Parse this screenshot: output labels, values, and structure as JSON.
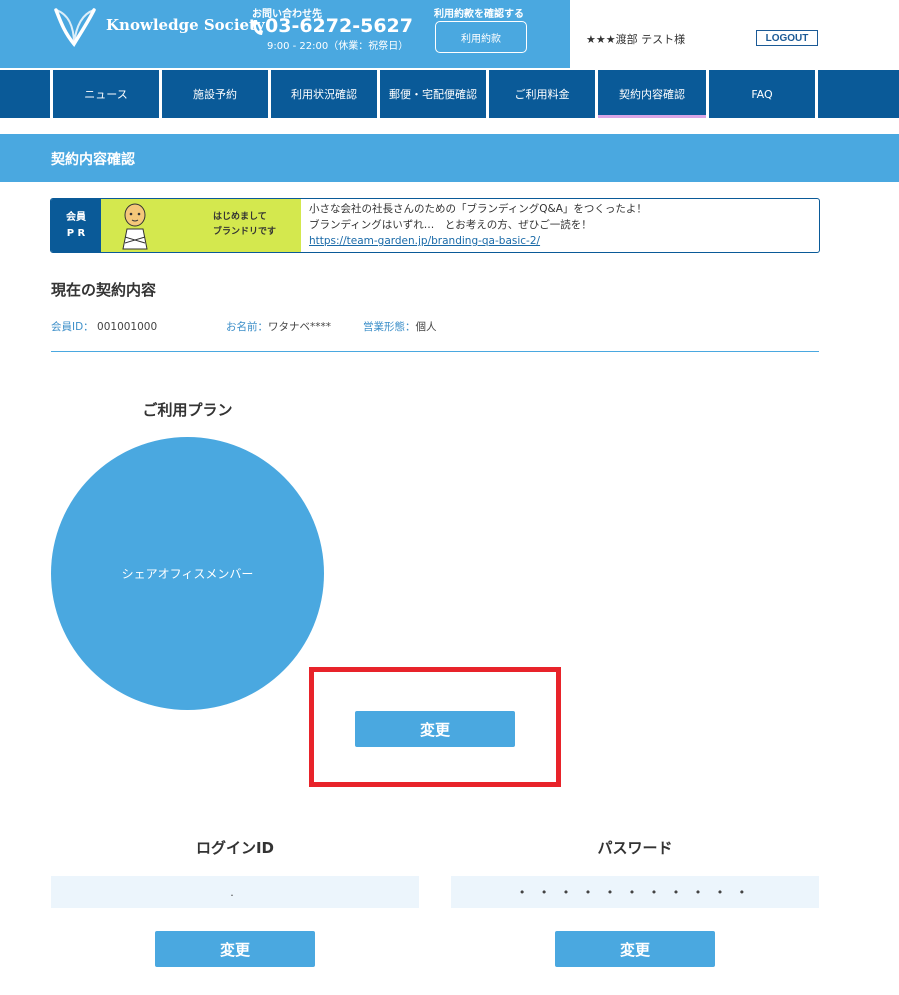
{
  "header": {
    "logo_text": "Knowledge Society",
    "contact_label": "お問い合わせ先",
    "phone": "03-6272-5627",
    "hours": "9:00 - 22:00（休業：祝祭日）",
    "terms_label": "利用約款を確認する",
    "terms_button": "利用約款",
    "user_name": "★★★渡部 テスト様",
    "logout": "LOGOUT",
    "colors": {
      "header_blue": "#4aa8e0",
      "nav_blue": "#0a5a98",
      "active_underline": "#d9a6e6"
    }
  },
  "nav": {
    "items": [
      {
        "label": "ニュース"
      },
      {
        "label": "施設予約"
      },
      {
        "label": "利用状況確認"
      },
      {
        "label": "郵便・宅配便確認"
      },
      {
        "label": "ご利用料金"
      },
      {
        "label": "契約内容確認",
        "active": true
      },
      {
        "label": "FAQ"
      }
    ]
  },
  "page": {
    "title": "契約内容確認"
  },
  "pr": {
    "label_line1": "会員",
    "label_line2": "P R",
    "image_text_line1": "はじめまして",
    "image_text_line2": "ブランドリです",
    "line1": "小さな会社の社長さんのための「ブランディングQ&A」をつくったよ！",
    "line2": "ブランディングはいずれ…　とお考えの方、ぜひご一読を！",
    "link": "https://team-garden.jp/branding-qa-basic-2/"
  },
  "contract": {
    "heading": "現在の契約内容",
    "member_id_label": "会員ID：",
    "member_id": "001001000",
    "name_label": "お名前：",
    "name": "ワタナベ****",
    "business_label": "営業形態：",
    "business": "個人"
  },
  "plan": {
    "heading": "ご利用プラン",
    "name": "シェアオフィスメンバー",
    "change_button": "変更",
    "highlight_color": "#e8232a"
  },
  "credentials": {
    "login_heading": "ログインID",
    "login_value": ".",
    "login_change": "変更",
    "password_heading": "パスワード",
    "password_value": "• • • • • • • • • • •",
    "password_change": "変更"
  }
}
